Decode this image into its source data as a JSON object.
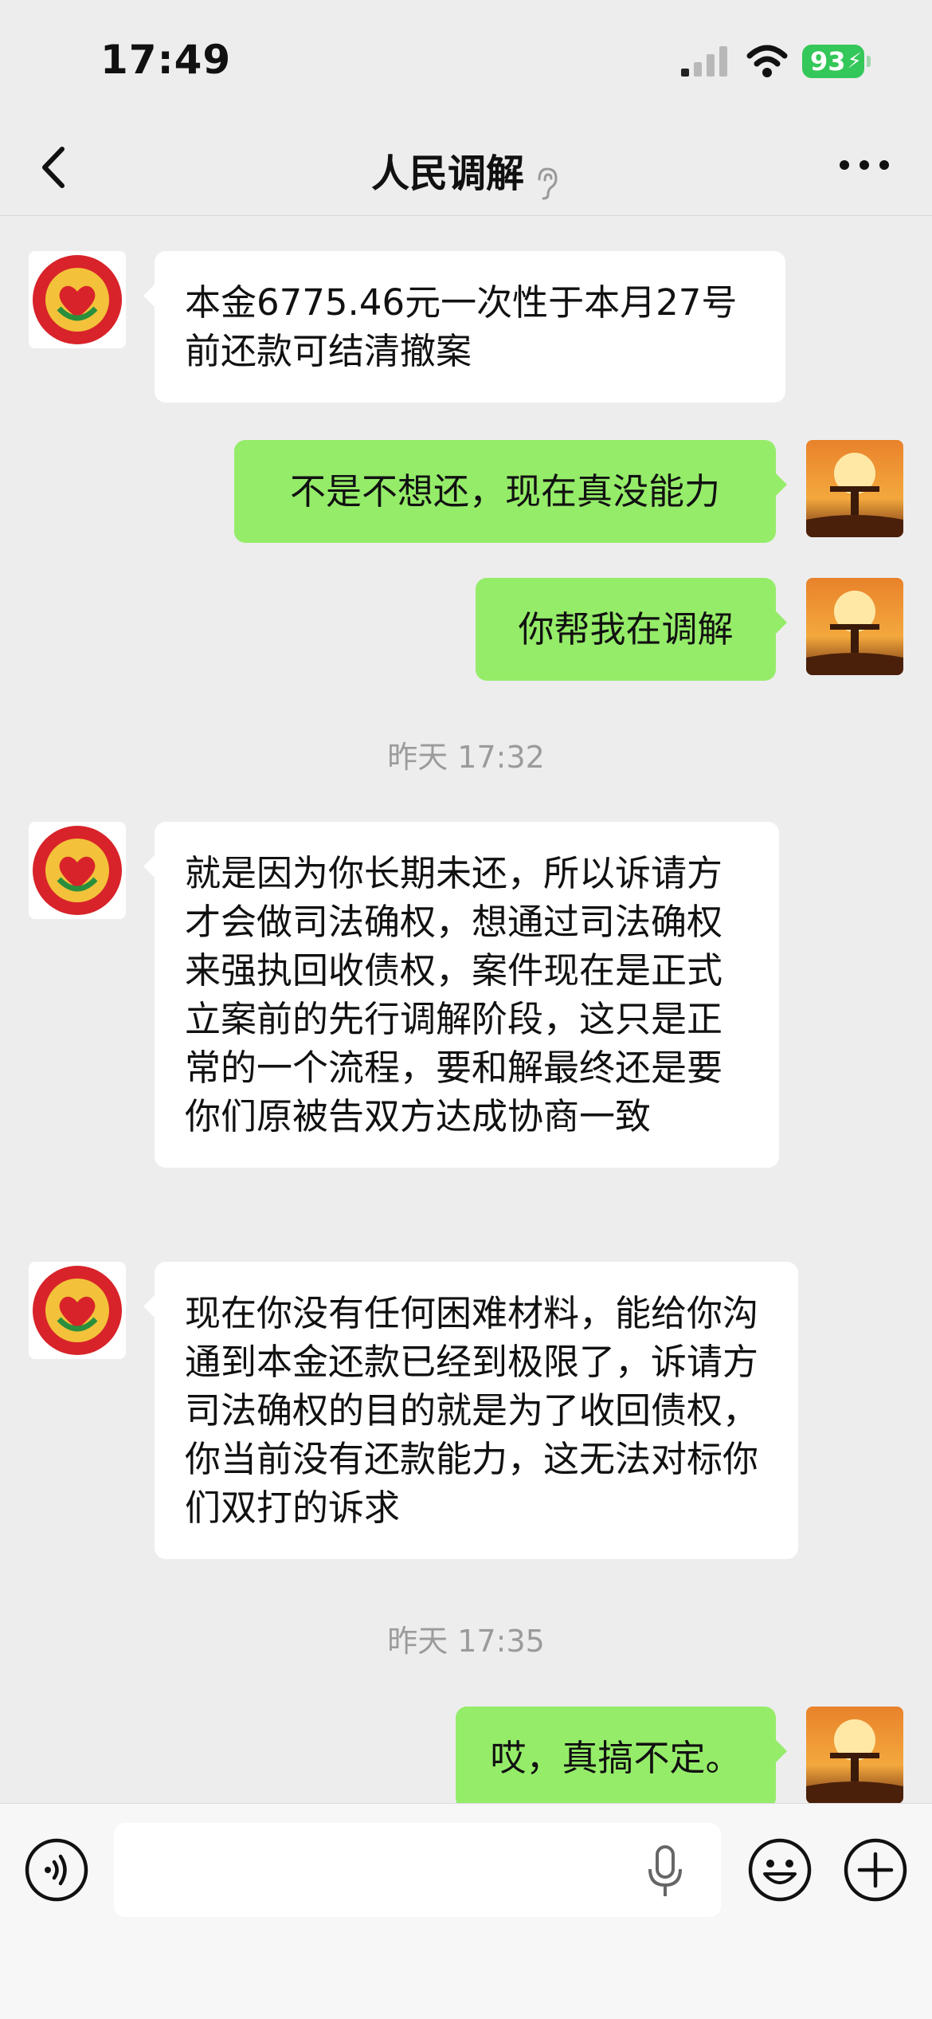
{
  "status_bar": {
    "time": "17:49",
    "battery": "93"
  },
  "header": {
    "title": "人民调解"
  },
  "messages": [
    {
      "side": "in",
      "text": "本金6775.46元一次性于本月27号前还款可结清撤案"
    },
    {
      "side": "out",
      "text": "不是不想还，现在真没能力"
    },
    {
      "side": "out",
      "text": "你帮我在调解"
    },
    {
      "side": "in",
      "text": "就是因为你长期未还，所以诉请方才会做司法确权，想通过司法确权来强执回收债权，案件现在是正式立案前的先行调解阶段，这只是正常的一个流程，要和解最终还是要你们原被告双方达成协商一致"
    },
    {
      "side": "in",
      "text": "现在你没有任何困难材料，能给你沟通到本金还款已经到极限了，诉请方司法确权的目的就是为了收回债权，你当前没有还款能力，这无法对标你们双打的诉求"
    },
    {
      "side": "out",
      "text": "哎，真搞不定。"
    }
  ],
  "timestamps": [
    "昨天 17:32",
    "昨天 17:35"
  ],
  "input": {
    "value": ""
  },
  "icons": {
    "back": "chevron-left-icon",
    "ear": "ear-icon",
    "more": "more-icon",
    "voice": "voice-icon",
    "mic": "microphone-icon",
    "emoji": "emoji-icon",
    "plus": "plus-icon"
  },
  "colors": {
    "background": "#ededed",
    "bubble_out": "#95ec69",
    "bubble_in": "#ffffff",
    "battery": "#34c759"
  }
}
